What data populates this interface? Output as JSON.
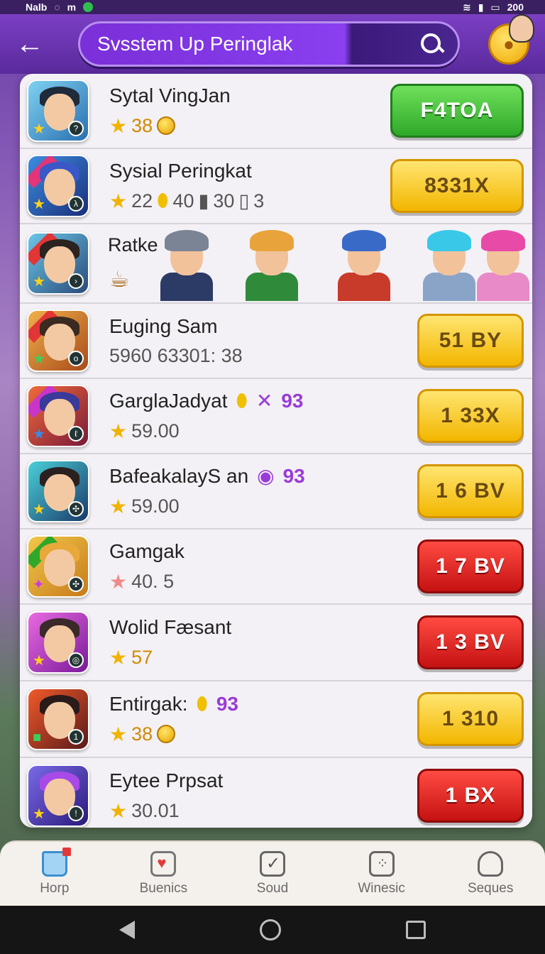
{
  "statusbar": {
    "left_text": "Nalb",
    "left_icon2": "m",
    "right_text": "200"
  },
  "header": {
    "search_text": "Svsstem Up Peringlak"
  },
  "rows": [
    {
      "name": "Sytal VingJan",
      "stat_text": "38",
      "button": "F4TOA"
    },
    {
      "name": "Sysial Peringkat",
      "stat_text": "22",
      "stat2": "40",
      "stat3": "30",
      "stat4": "3",
      "button": "8331X"
    },
    {
      "title": "Ratke"
    },
    {
      "name": "Euging Sam",
      "stat_text": "5960 63301: 38",
      "button": "51 BY"
    },
    {
      "name": "GarglaJadyat",
      "extra": "93",
      "stat_text": "59.00",
      "button": "1 33X"
    },
    {
      "name": "BafeakalayS an",
      "extra": "93",
      "stat_text": "59.00",
      "button": "1 6 BV"
    },
    {
      "name": "Gamgak",
      "stat_text": "40. 5",
      "button": "1 7 BV"
    },
    {
      "name": "Wolid Fæsant",
      "stat_text": "57",
      "button": "1 3 BV"
    },
    {
      "name": "Entirgak:",
      "extra": "93",
      "stat_text": "38",
      "button": "1 310"
    },
    {
      "name": "Eytee Prpsat",
      "stat_text": "30.01",
      "button": "1 BX"
    }
  ],
  "bottomnav": [
    {
      "label": "Horp",
      "icon": "home-icon"
    },
    {
      "label": "Buenics",
      "icon": "heart-icon"
    },
    {
      "label": "Soud",
      "icon": "check-icon"
    },
    {
      "label": "Winesic",
      "icon": "dice-icon"
    },
    {
      "label": "Seques",
      "icon": "user-icon"
    }
  ],
  "colors": {
    "accent": "#7b3fc4",
    "green": "#2fa82a",
    "yellow": "#f2b600",
    "red": "#c51212"
  }
}
